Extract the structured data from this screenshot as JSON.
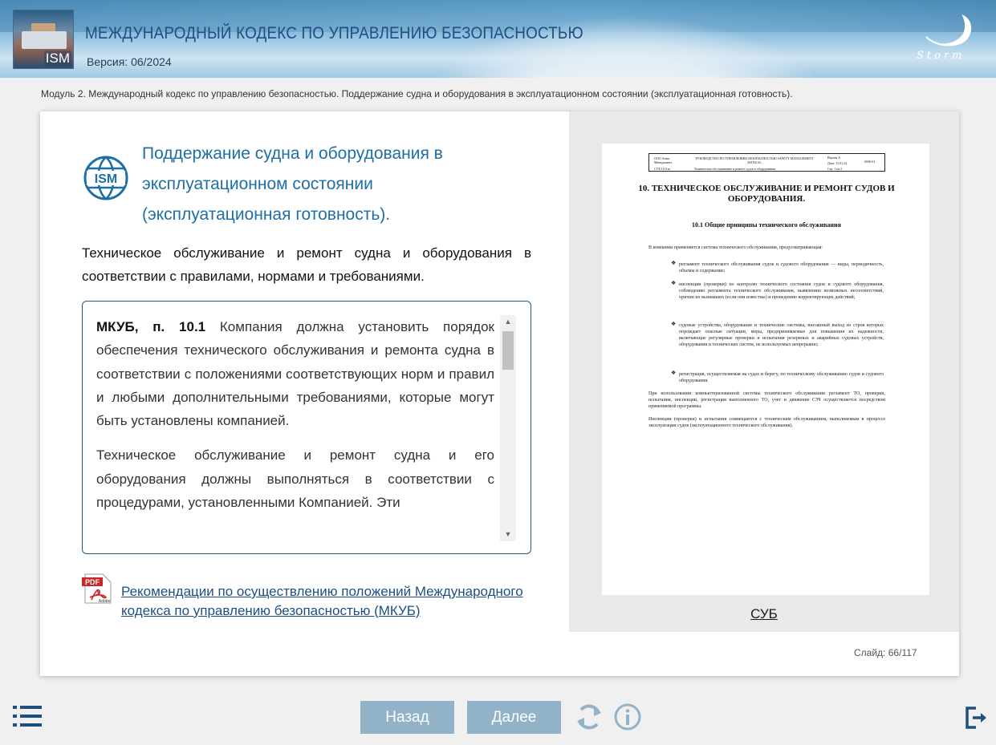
{
  "header": {
    "title": "МЕЖДУНАРОДНЫЙ КОДЕКС ПО УПРАВЛЕНИЮ БЕЗОПАСНОСТЬЮ",
    "version": "Версия: 06/2024",
    "logo_text": "ISM",
    "brand": "Storm"
  },
  "breadcrumb": "Модуль 2. Международный кодекс по управлению безопасностью. Поддержание судна и оборудования в эксплуатационном состоянии (эксплуатационная готовность).",
  "slide": {
    "badge_text": "ISM",
    "title": "Поддержание судна и оборудования в эксплуатационном состоянии (эксплуатационная готовность).",
    "subtitle": "Техническое обслуживание и ремонт судна и оборудования в соответствии с правилами, нормами и требованиями.",
    "quote": {
      "ref": "МКУБ, п. 10.1",
      "text1": " Компания должна установить порядок обеспечения технического обслуживания и ремонта судна в соответствии с положениями соответствующих норм и правил и любыми дополнительными требованиями, которые могут быть установлены компанией.",
      "text2": "Техническое обслуживание и ремонт судна и его оборудования должны выполняться в соответствии с процедурами, установленными Компанией. Эти"
    },
    "pdf_icon_text": "PDF",
    "pdf_icon_sub": "Adobe",
    "pdf_link": "Рекомендации по осуществлению положений Международного кодекса по управлению безопасностью (МКУБ)"
  },
  "document": {
    "head": {
      "c1": "ООО Анна-Менеджмент",
      "c2": "РУКОВОДСТВО ПО УПРАВЛЕНИЮ БЕЗОПАСНОСТЬЮ SAFETY MANAGEMENT MANUAL",
      "c3": "Версия А",
      "c4": "Дата: 15.01.24",
      "c5": "SMS-01",
      "c6": "СУБ 10.0.m",
      "c7": "Техническое обслуживание и ремонт судов и оборудования",
      "c8": "Стр. 1 из 2"
    },
    "h1": "10. ТЕХНИЧЕСКОЕ ОБСЛУЖИВАНИЕ И РЕМОНТ СУДОВ И ОБОРУДОВАНИЯ.",
    "h2": "10.1 Общие принципы технического обслуживания",
    "intro": "В компании применяется система технического обслуживания, предусматривающая:",
    "bullets": [
      "регламент технического обслуживания судов и судового оборудования — виды, периодичность, объемы и содержание;",
      "инспекции (проверки) по контролю технического состояния судов и судового оборудования, соблюдению регламента технического обслуживания, выявлению возможных несоответствий, причин их вызвавших (если они известны) и проведению корректирующих действий;",
      "судовые устройства, оборудование и технические системы, внезапный выход из строя которых порождает опасные ситуации, меры, предпринимаемые для повышения их надежности, включающие регулярные проверки и испытания резервных и аварийных судовых устройств, оборудования и технических систем, не используемых непрерывно;",
      "регистрация, осуществляемая на судах и берегу, по техническому обслуживанию судов и судового оборудования."
    ],
    "para2": "При использовании компьютеризованной системы технического обслуживания регламент ТО, проверки, испытания, инспекции, регистрация выполненного ТО, учет и движение СЗЧ осуществляется посредством применяемой программы.",
    "para3": "Инспекции (проверки) и испытания совмещаются с техническим обслуживанием, выполняемым в процессе эксплуатации судов (эксплуатационного технического обслуживания).",
    "caption": "СУБ"
  },
  "slide_counter": {
    "label": "Слайд:",
    "current": "66",
    "separator": "/",
    "total": "117"
  },
  "footer": {
    "back_label": "Назад",
    "next_label": "Далее",
    "icons": [
      "menu-icon",
      "reload-icon",
      "info-icon",
      "exit-icon"
    ]
  },
  "colors": {
    "accent": "#1d6fa5",
    "button": "#92b2c7",
    "header_title": "#1f4f80"
  }
}
